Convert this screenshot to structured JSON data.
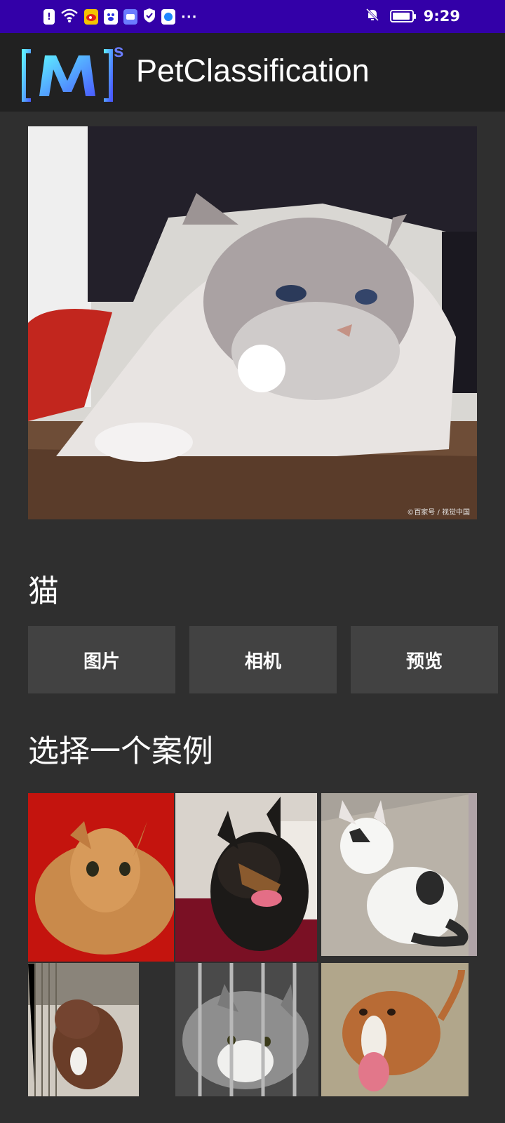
{
  "status_bar": {
    "time": "9:29",
    "left_icons": [
      "alert-icon",
      "wifi-icon",
      "weibo-icon",
      "baidu-icon",
      "app-icon",
      "shield-icon",
      "browser-icon"
    ],
    "more": "···",
    "right_icons": [
      "bell-muted-icon",
      "battery-icon"
    ]
  },
  "app_bar": {
    "logo_text": "[M]",
    "logo_superscript": "s",
    "title": "PetClassification"
  },
  "main_image": {
    "subject": "cat",
    "watermark": "©百家号 / 视觉中国"
  },
  "result": {
    "label": "猫"
  },
  "buttons": {
    "image": "图片",
    "camera": "相机",
    "preview": "预览"
  },
  "examples": {
    "title": "选择一个案例",
    "items": [
      {
        "subject": "cat"
      },
      {
        "subject": "dog"
      },
      {
        "subject": "cat"
      },
      {
        "subject": "dog"
      },
      {
        "subject": "cat"
      },
      {
        "subject": "dog"
      }
    ]
  },
  "colors": {
    "status_bar": "#3300a8",
    "app_bar": "#212121",
    "background": "#2f2f2f",
    "button": "#424242"
  }
}
